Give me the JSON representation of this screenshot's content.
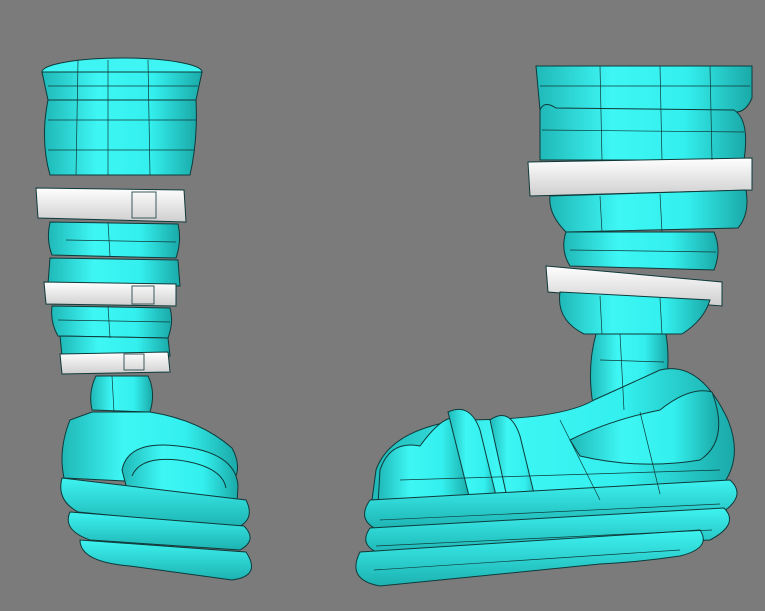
{
  "viewport": {
    "background": "#7b7b7b"
  },
  "model": {
    "colors": {
      "mesh": "#33f0ee",
      "mesh_shade": "#22c9c8",
      "mesh_dark": "#179a9a",
      "wire": "#0f3a3a",
      "strap": "#f1f1f1",
      "strap_shade": "#cfcfcf"
    },
    "views": [
      {
        "id": "front-view",
        "icon": "boot-front-icon"
      },
      {
        "id": "side-view",
        "icon": "boot-side-icon"
      }
    ]
  }
}
